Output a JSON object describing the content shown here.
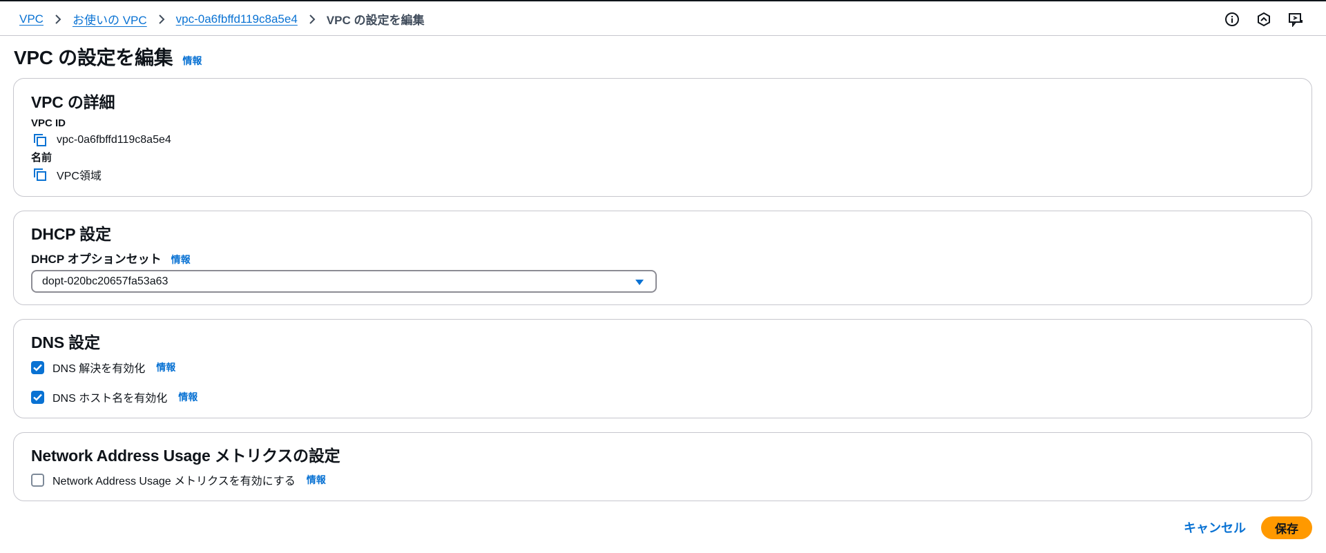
{
  "breadcrumb": {
    "items": [
      "VPC",
      "お使いの VPC",
      "vpc-0a6fbffd119c8a5e4"
    ],
    "current": "VPC の設定を編集"
  },
  "top_icons": [
    "info-icon",
    "notification-icon",
    "feedback-icon"
  ],
  "page": {
    "title": "VPC の設定を編集",
    "info": "情報"
  },
  "vpc_details": {
    "title": "VPC の詳細",
    "id_label": "VPC ID",
    "id_value": "vpc-0a6fbffd119c8a5e4",
    "name_label": "名前",
    "name_value": "VPC領域"
  },
  "dhcp": {
    "title": "DHCP 設定",
    "option_label": "DHCP オプションセット",
    "info": "情報",
    "selected": "dopt-020bc20657fa53a63"
  },
  "dns": {
    "title": "DNS 設定",
    "resolution_label": "DNS 解決を有効化",
    "resolution_checked": true,
    "hostnames_label": "DNS ホスト名を有効化",
    "hostnames_checked": true,
    "info": "情報"
  },
  "nau": {
    "title": "Network Address Usage メトリクスの設定",
    "enable_label": "Network Address Usage メトリクスを有効にする",
    "enable_checked": false,
    "info": "情報"
  },
  "actions": {
    "cancel": "キャンセル",
    "save": "保存"
  },
  "colors": {
    "link": "#0972d3",
    "primary_button": "#ff9900",
    "border": "#c6c6cd",
    "text": "#0f141a"
  }
}
